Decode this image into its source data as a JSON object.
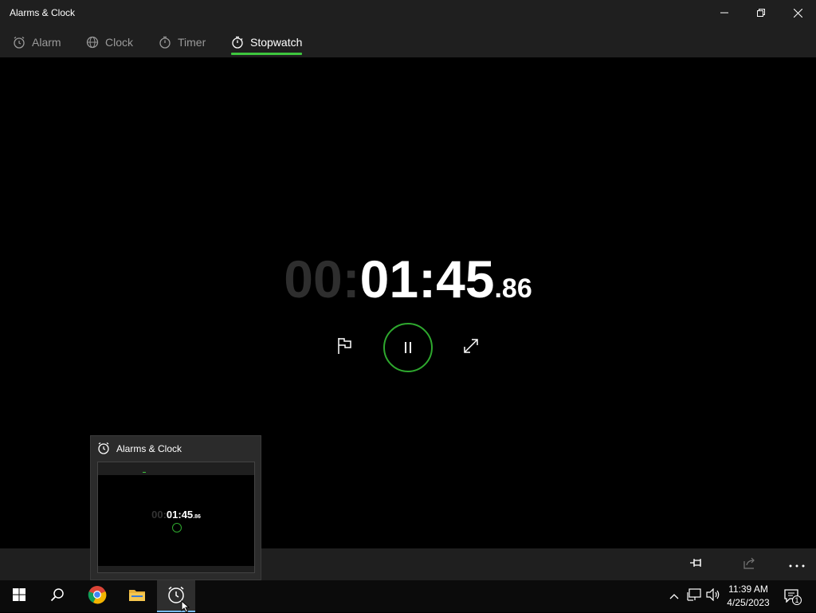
{
  "window": {
    "title": "Alarms & Clock"
  },
  "nav": {
    "tabs": [
      {
        "label": "Alarm",
        "icon": "alarm-icon"
      },
      {
        "label": "Clock",
        "icon": "globe-clock-icon"
      },
      {
        "label": "Timer",
        "icon": "timer-icon"
      },
      {
        "label": "Stopwatch",
        "icon": "stopwatch-icon",
        "active": true
      }
    ]
  },
  "stopwatch": {
    "hours": "00",
    "sep1": ":",
    "minutes": "01",
    "sep2": ":",
    "seconds": "45",
    "fraction": ".86"
  },
  "controls": {
    "lap_icon": "flag-icon",
    "pause_icon": "pause-icon",
    "expand_icon": "expand-icon"
  },
  "preview": {
    "title": "Alarms & Clock",
    "hours": "00",
    "time": "01:45",
    "fraction": ".86"
  },
  "taskbar": {
    "time": "11:39 AM",
    "date": "4/25/2023",
    "notification_count": "1"
  },
  "colors": {
    "accent_green": "#3ec63e",
    "taskbar_indicator": "#76b9ed"
  }
}
